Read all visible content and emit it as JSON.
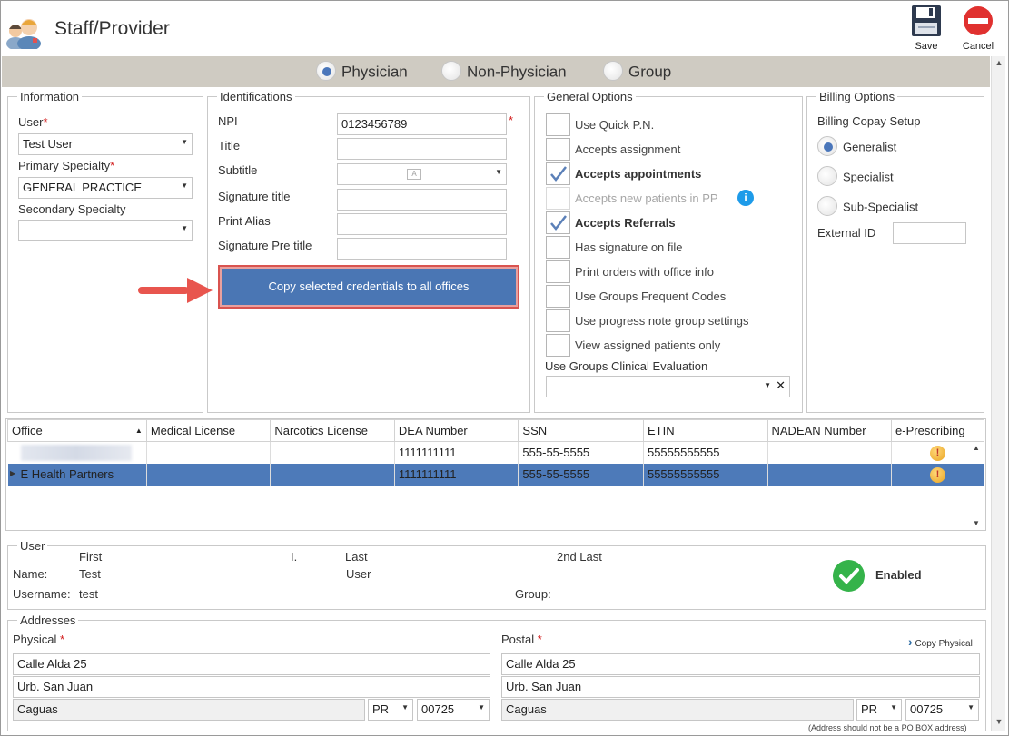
{
  "window": {
    "title": "Staff/Provider"
  },
  "toolbar": {
    "save_label": "Save",
    "cancel_label": "Cancel"
  },
  "provider_type": {
    "options": [
      "Physician",
      "Non-Physician",
      "Group"
    ],
    "selected": "Physician"
  },
  "information": {
    "legend": "Information",
    "user_label": "User",
    "user_value": "Test User",
    "primary_specialty_label": "Primary Specialty",
    "primary_specialty_value": "GENERAL PRACTICE",
    "secondary_specialty_label": "Secondary Specialty",
    "secondary_specialty_value": ""
  },
  "identifications": {
    "legend": "Identifications",
    "npi_label": "NPI",
    "npi_value": "0123456789",
    "title_label": "Title",
    "subtitle_label": "Subtitle",
    "signature_title_label": "Signature title",
    "print_alias_label": "Print Alias",
    "signature_pre_title_label": "Signature Pre title",
    "copy_button": "Copy selected credentials to all offices"
  },
  "general_options": {
    "legend": "General Options",
    "items": [
      {
        "label": "Use Quick P.N.",
        "checked": false
      },
      {
        "label": "Accepts assignment",
        "checked": false
      },
      {
        "label": "Accepts appointments",
        "checked": true
      },
      {
        "label": "Accepts new patients in PP",
        "checked": false,
        "disabled": true
      },
      {
        "label": "Accepts Referrals",
        "checked": true
      },
      {
        "label": "Has signature on file",
        "checked": false
      },
      {
        "label": "Print orders with office info",
        "checked": false
      },
      {
        "label": "Use Groups Frequent Codes",
        "checked": false
      },
      {
        "label": "Use progress note group settings",
        "checked": false
      },
      {
        "label": "View assigned patients only",
        "checked": false
      }
    ],
    "clinical_eval_label": "Use Groups Clinical Evaluation",
    "clinical_eval_value": ""
  },
  "billing_options": {
    "legend": "Billing Options",
    "copay_label": "Billing Copay Setup",
    "copay_options": [
      "Generalist",
      "Specialist",
      "Sub-Specialist"
    ],
    "selected": "Generalist",
    "external_id_label": "External ID",
    "external_id_value": ""
  },
  "offices_table": {
    "columns": [
      "Office",
      "Medical License",
      "Narcotics License",
      "DEA Number",
      "SSN",
      "ETIN",
      "NADEAN Number",
      "e-Prescribing"
    ],
    "rows": [
      {
        "office": "",
        "medical_license": "",
        "narcotics_license": "",
        "dea": "1111111111",
        "ssn": "555-55-5555",
        "etin": "55555555555",
        "nadean": ""
      },
      {
        "office": "E Health Partners",
        "medical_license": "",
        "narcotics_license": "",
        "dea": "1111111111",
        "ssn": "555-55-5555",
        "etin": "55555555555",
        "nadean": ""
      }
    ]
  },
  "user_section": {
    "legend": "User",
    "first_header": "First",
    "initial_header": "I.",
    "last_header": "Last",
    "second_last_header": "2nd Last",
    "name_label": "Name:",
    "first_value": "Test",
    "last_value": "User",
    "username_label": "Username:",
    "username_value": "test",
    "group_label": "Group:",
    "group_value": "",
    "status": "Enabled"
  },
  "addresses": {
    "legend": "Addresses",
    "physical_label": "Physical",
    "postal_label": "Postal",
    "copy_physical": "Copy Physical",
    "physical": {
      "line1": "Calle Alda 25",
      "line2": "Urb. San Juan",
      "city": "Caguas",
      "state": "PR",
      "zip": "00725"
    },
    "postal": {
      "line1": "Calle Alda 25",
      "line2": "Urb. San Juan",
      "city": "Caguas",
      "state": "PR",
      "zip": "00725"
    },
    "note": "(Address should not be a PO BOX address)"
  },
  "colors": {
    "accent": "#4a76b4",
    "required": "#d21a1a",
    "enabled": "#35b34a",
    "arrow": "#e8554e"
  }
}
